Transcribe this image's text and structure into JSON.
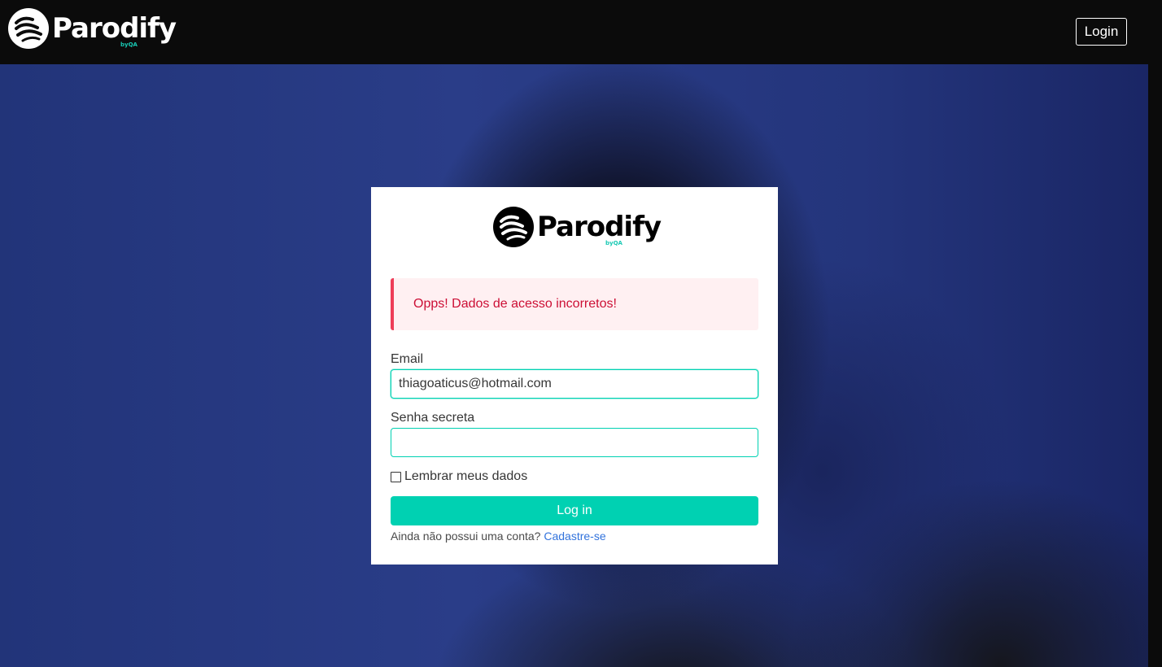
{
  "navbar": {
    "brand_name": "Parodify",
    "brand_sub": "byQA",
    "login_label": "Login"
  },
  "card": {
    "logo_name": "Parodify",
    "logo_sub": "byQA",
    "alert_text": "Opps! Dados de acesso incorretos!",
    "email_label": "Email",
    "email_value": "thiagoaticus@hotmail.com",
    "password_label": "Senha secreta",
    "password_value": "",
    "remember_label": "Lembrar meus dados",
    "submit_label": "Log in",
    "signup_prompt": "Ainda não possui uma conta?",
    "signup_link": "Cadastre-se"
  },
  "colors": {
    "accent": "#00d1b2",
    "danger": "#cc0f35",
    "link": "#3273dc"
  }
}
